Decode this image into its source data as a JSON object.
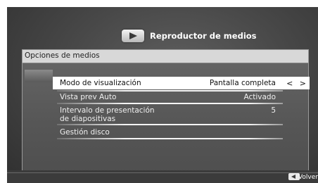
{
  "header": {
    "title": "Reproductor de medios",
    "icon": "play-icon"
  },
  "panel": {
    "title": "Opciones de medios"
  },
  "rows": [
    {
      "label": "Modo de visualización",
      "value": "Pantalla completa",
      "selected": true,
      "arrows": "< >"
    },
    {
      "label": "Vista prev Auto",
      "value": "Activado"
    },
    {
      "label_line1": "Intervalo de presentación",
      "label_line2": "de diapositivas",
      "value": "5"
    },
    {
      "label": "Gestión disco",
      "value": ""
    }
  ],
  "footer": {
    "back_label": "Volver",
    "back_icon": "back-arrow-icon"
  },
  "colors": {
    "selected_bg": "#ffffff",
    "panel_title_bg": "#d8d8d8",
    "screen_bg": "#484848"
  }
}
